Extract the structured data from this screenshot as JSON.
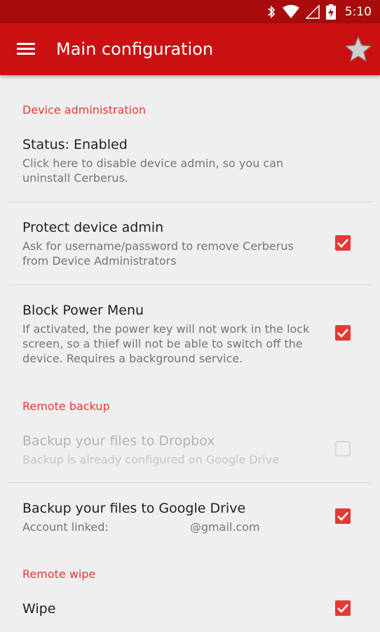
{
  "status_bar": {
    "time": "5:10",
    "icons": [
      "bluetooth-icon",
      "wifi-icon",
      "cell-signal-icon",
      "battery-charging-icon"
    ]
  },
  "app_bar": {
    "menu_icon": "hamburger-menu-icon",
    "title": "Main configuration",
    "star_icon": "star-icon"
  },
  "colors": {
    "status_bar": "#a70d0d",
    "app_bar": "#c91111",
    "accent": "#e53935",
    "background": "#efefef"
  },
  "sections": {
    "device_admin": "Device administration",
    "remote_backup": "Remote backup",
    "remote_wipe": "Remote wipe"
  },
  "prefs": {
    "status": {
      "title": "Status: Enabled",
      "summary": "Click here to disable device admin, so you can uninstall Cerberus."
    },
    "protect_admin": {
      "title": "Protect device admin",
      "summary": "Ask for username/password to remove Cerberus from Device Administrators",
      "checked": true
    },
    "block_power": {
      "title": "Block Power Menu",
      "summary": "If activated, the power key will not work in the lock screen, so a thief will not be able to switch off the device. Requires a background service.",
      "checked": true
    },
    "dropbox": {
      "title": "Backup your files to Dropbox",
      "summary": "Backup is already configured on Google Drive",
      "checked": false,
      "enabled": false
    },
    "gdrive": {
      "title": "Backup your files to Google Drive",
      "summary_label": "Account linked:",
      "summary_email": "@gmail.com",
      "checked": true
    },
    "wipe": {
      "title": "Wipe",
      "checked": true
    }
  }
}
